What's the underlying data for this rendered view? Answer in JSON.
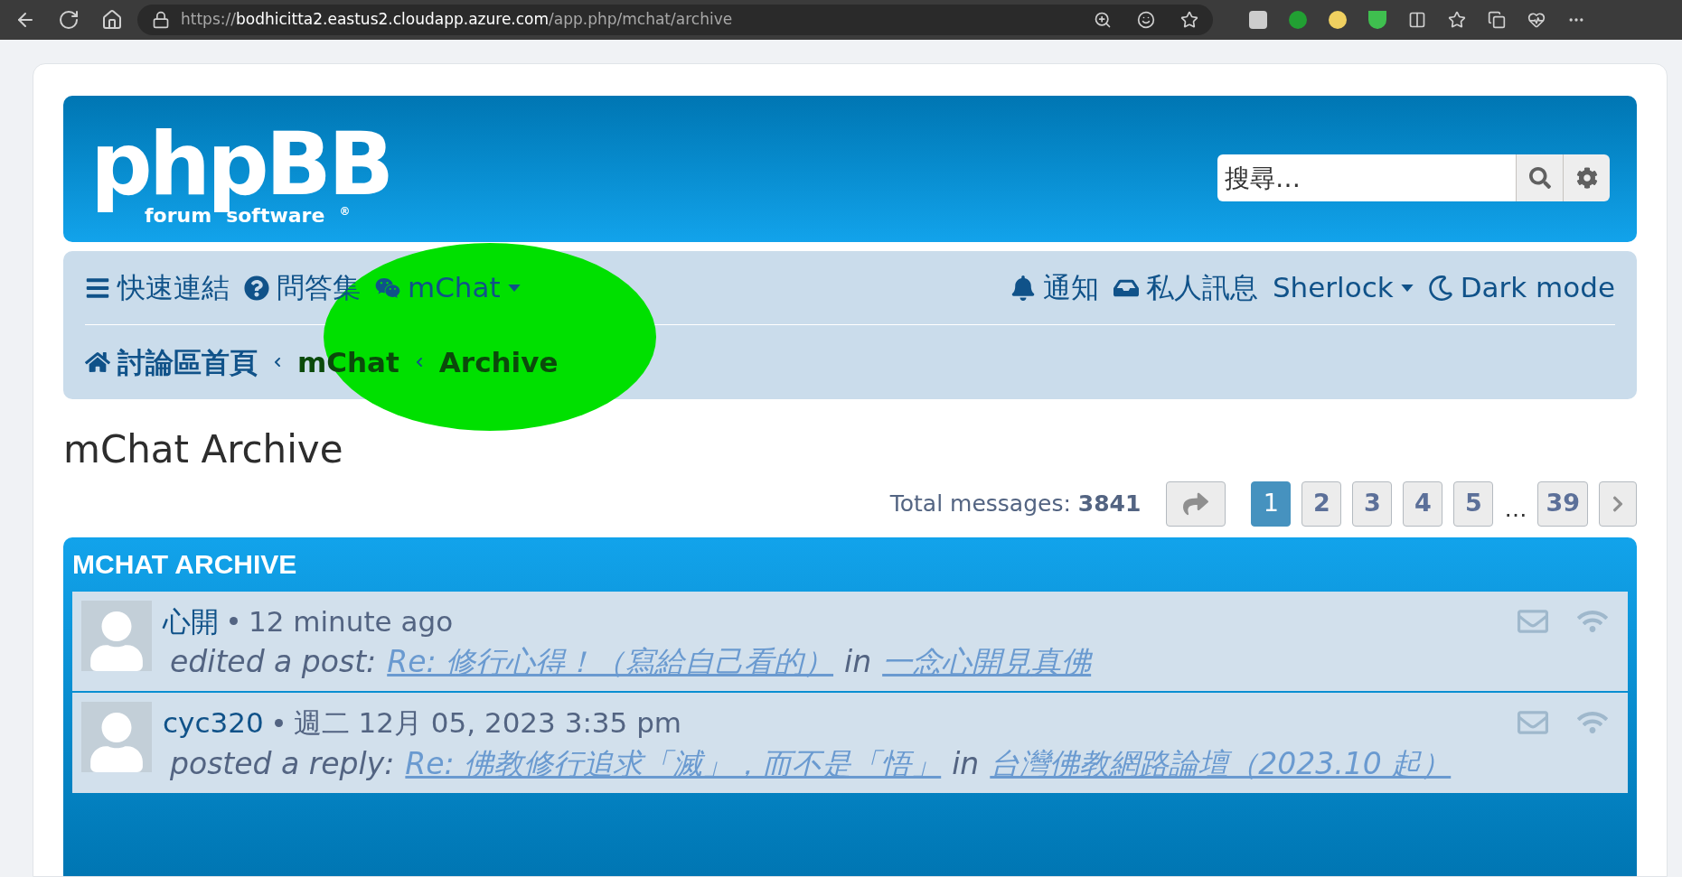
{
  "browser": {
    "url_scheme": "https://",
    "url_host": "bodhicitta2.eastus2.cloudapp.azure.com",
    "url_path": "/app.php/mchat/archive"
  },
  "header": {
    "logo": {
      "word": "phpBB",
      "left": "forum",
      "right": "software",
      "mark": "®"
    },
    "search": {
      "placeholder": "搜尋…"
    }
  },
  "nav": {
    "left": [
      {
        "kind": "bars",
        "label": "快速連結",
        "dropdown": false
      },
      {
        "kind": "question",
        "label": "問答集",
        "dropdown": false
      },
      {
        "kind": "chat",
        "label": "mChat",
        "dropdown": true
      }
    ],
    "right": [
      {
        "kind": "bell",
        "label": "通知",
        "dropdown": false
      },
      {
        "kind": "inbox",
        "label": "私人訊息",
        "dropdown": false
      },
      {
        "kind": "none",
        "label": "Sherlock",
        "dropdown": true
      },
      {
        "kind": "moon",
        "label": "Dark mode",
        "dropdown": false
      }
    ]
  },
  "breadcrumbs": [
    "討論區首頁",
    "mChat",
    "Archive"
  ],
  "title": "mChat Archive",
  "pagination": {
    "total_label": "Total messages:",
    "total": "3841",
    "pages": [
      {
        "kind": "page",
        "label": "1",
        "selected": true
      },
      {
        "kind": "page",
        "label": "2",
        "selected": false
      },
      {
        "kind": "page",
        "label": "3",
        "selected": false
      },
      {
        "kind": "page",
        "label": "4",
        "selected": false
      },
      {
        "kind": "page",
        "label": "5",
        "selected": false
      },
      {
        "kind": "ellipsis",
        "label": "…"
      },
      {
        "kind": "page",
        "label": "39",
        "selected": false
      }
    ]
  },
  "archive": {
    "title": "MCHAT ARCHIVE",
    "messages": [
      {
        "user": "心開",
        "time": "12 minute ago",
        "action": "edited a post:",
        "topic": "Re: 修行心得！（寫給自己看的）",
        "in": "in",
        "forum": "一念心開見真佛"
      },
      {
        "user": "cyc320",
        "time": "週二 12月 05, 2023 3:35 pm",
        "action": "posted a reply:",
        "topic": "Re: 佛教修行追求「滅」，而不是「悟」",
        "in": "in",
        "forum": "台灣佛教網路論壇（2023.10 起）"
      }
    ]
  }
}
